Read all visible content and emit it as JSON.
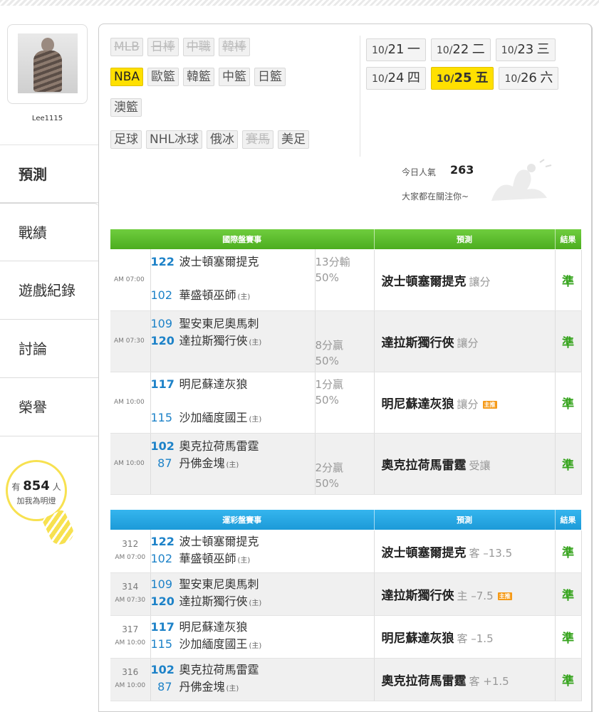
{
  "profile": {
    "username": "Lee1115"
  },
  "nav": [
    {
      "label": "預測",
      "active": true
    },
    {
      "label": "戰績"
    },
    {
      "label": "遊戲紀錄"
    },
    {
      "label": "討論"
    },
    {
      "label": "榮譽"
    }
  ],
  "fans": {
    "prefix": "有",
    "count": "854",
    "suffix": "人",
    "caption": "加我為明燈"
  },
  "sports": {
    "row1": [
      {
        "label": "MLB",
        "state": "disabled"
      },
      {
        "label": "日棒",
        "state": "disabled"
      },
      {
        "label": "中職",
        "state": "disabled"
      },
      {
        "label": "韓棒",
        "state": "disabled"
      }
    ],
    "row2": [
      {
        "label": "NBA",
        "state": "active"
      },
      {
        "label": "歐籃"
      },
      {
        "label": "韓籃"
      },
      {
        "label": "中籃"
      },
      {
        "label": "日籃"
      }
    ],
    "row3": [
      {
        "label": "澳籃"
      }
    ],
    "row4": [
      {
        "label": "足球"
      },
      {
        "label": "NHL冰球"
      },
      {
        "label": "俄冰"
      },
      {
        "label": "賽馬",
        "state": "disabled"
      },
      {
        "label": "美足"
      }
    ]
  },
  "dates": [
    {
      "md": "10/",
      "day": "21",
      "wd": "一"
    },
    {
      "md": "10/",
      "day": "22",
      "wd": "二"
    },
    {
      "md": "10/",
      "day": "23",
      "wd": "三"
    },
    {
      "md": "10/",
      "day": "24",
      "wd": "四"
    },
    {
      "md": "10/",
      "day": "25",
      "wd": "五",
      "active": true
    },
    {
      "md": "10/",
      "day": "26",
      "wd": "六"
    }
  ],
  "popularity": {
    "label": "今日人氣",
    "value": "263",
    "sub": "大家都在關注你~"
  },
  "intl": {
    "headers": {
      "games": "國際盤賽事",
      "pred": "預測",
      "result": "結果"
    },
    "rows": [
      {
        "time": "AM 07:00",
        "s1": "122",
        "t1": "波士頓塞爾提克",
        "s2": "102",
        "t2": "華盛頓巫師",
        "home": "(主)",
        "o1": "13分輸",
        "o2": "50%",
        "pick": "波士頓塞爾提克",
        "note": "讓分",
        "badge": "",
        "res": "準"
      },
      {
        "time": "AM 07:30",
        "s1": "109",
        "t1": "聖安東尼奧馬刺",
        "s2": "120",
        "t2": "達拉斯獨行俠",
        "home": "(主)",
        "o1": "8分贏",
        "o2": "50%",
        "pick": "達拉斯獨行俠",
        "note": "讓分",
        "badge": "",
        "res": "準"
      },
      {
        "time": "AM 10:00",
        "s1": "117",
        "t1": "明尼蘇達灰狼",
        "s2": "115",
        "t2": "沙加緬度國王",
        "home": "(主)",
        "o1": "1分贏",
        "o2": "50%",
        "pick": "明尼蘇達灰狼",
        "note": "讓分",
        "badge": "主推",
        "res": "準"
      },
      {
        "time": "AM 10:00",
        "s1": "102",
        "t1": "奧克拉荷馬雷霆",
        "s2": "87",
        "t2": "丹佛金塊",
        "home": "(主)",
        "o1": "2分贏",
        "o2": "50%",
        "pick": "奧克拉荷馬雷霆",
        "note": "受讓",
        "badge": "",
        "res": "準"
      }
    ]
  },
  "lottery": {
    "headers": {
      "games": "運彩盤賽事",
      "pred": "預測",
      "result": "結果"
    },
    "rows": [
      {
        "num": "312",
        "time": "AM 07:00",
        "s1": "122",
        "t1": "波士頓塞爾提克",
        "s2": "102",
        "t2": "華盛頓巫師",
        "home": "(主)",
        "pick": "波士頓塞爾提克",
        "note": "客 –13.5",
        "badge": "",
        "res": "準"
      },
      {
        "num": "314",
        "time": "AM 07:30",
        "s1": "109",
        "t1": "聖安東尼奧馬刺",
        "s2": "120",
        "t2": "達拉斯獨行俠",
        "home": "(主)",
        "pick": "達拉斯獨行俠",
        "note": "主 –7.5",
        "badge": "主推",
        "res": "準"
      },
      {
        "num": "317",
        "time": "AM 10:00",
        "s1": "117",
        "t1": "明尼蘇達灰狼",
        "s2": "115",
        "t2": "沙加緬度國王",
        "home": "(主)",
        "pick": "明尼蘇達灰狼",
        "note": "客 –1.5",
        "badge": "",
        "res": "準"
      },
      {
        "num": "316",
        "time": "AM 10:00",
        "s1": "102",
        "t1": "奧克拉荷馬雷霆",
        "s2": "87",
        "t2": "丹佛金塊",
        "home": "(主)",
        "pick": "奧克拉荷馬雷霆",
        "note": "客 +1.5",
        "badge": "",
        "res": "準"
      }
    ]
  }
}
